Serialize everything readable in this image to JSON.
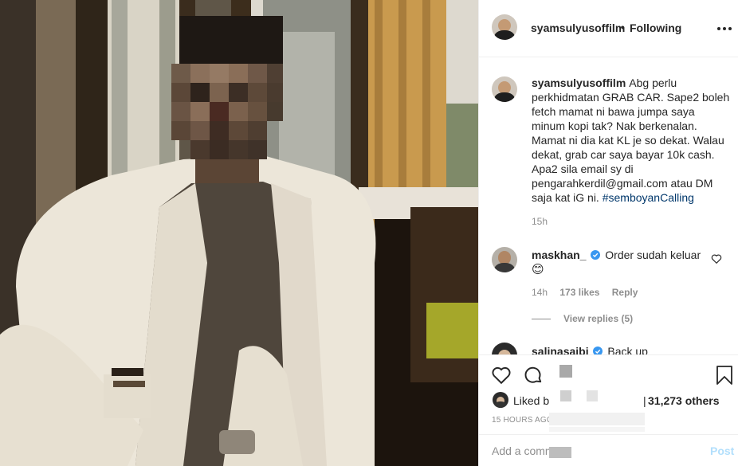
{
  "post": {
    "username": "syamsulyusoffilm",
    "separator": "•",
    "follow_status": "Following",
    "caption": "Abg perlu perkhidmatan GRAB CAR. Sape2 boleh fetch mamat ni bawa jumpa saya minum kopi tak? Nak berkenalan. Mamat ni dia kat KL je so dekat. Walau dekat, grab car saya bayar 10k cash. Apa2 sila email sy di pengarahkerdil@gmail.com atau DM saja kat iG ni.",
    "hashtag": "#semboyanCalling",
    "caption_time": "15h"
  },
  "comments": [
    {
      "username": "maskhan_",
      "verified": true,
      "text": "Order sudah keluar",
      "emoji": "😊",
      "time": "14h",
      "likes": "173 likes",
      "reply": "Reply",
      "view_replies": "View replies (5)"
    },
    {
      "username": "salinasaibi",
      "verified": true,
      "text": "Back up"
    }
  ],
  "footer": {
    "liked_by_prefix": "Liked b",
    "liked_others": "31,273 others",
    "timestamp": "15 HOURS AGO",
    "comment_placeholder": "Add a comm",
    "post_label": "Post"
  },
  "colors": {
    "text": "#262626",
    "muted": "#8e8e8e",
    "link": "#00376b",
    "verified": "#3897f0",
    "post_disabled": "#b2dffc",
    "border": "#efefef"
  },
  "icons": [
    "more-icon",
    "heart-icon",
    "comment-icon",
    "bookmark-icon",
    "verified-icon",
    "heart-outline-icon"
  ]
}
